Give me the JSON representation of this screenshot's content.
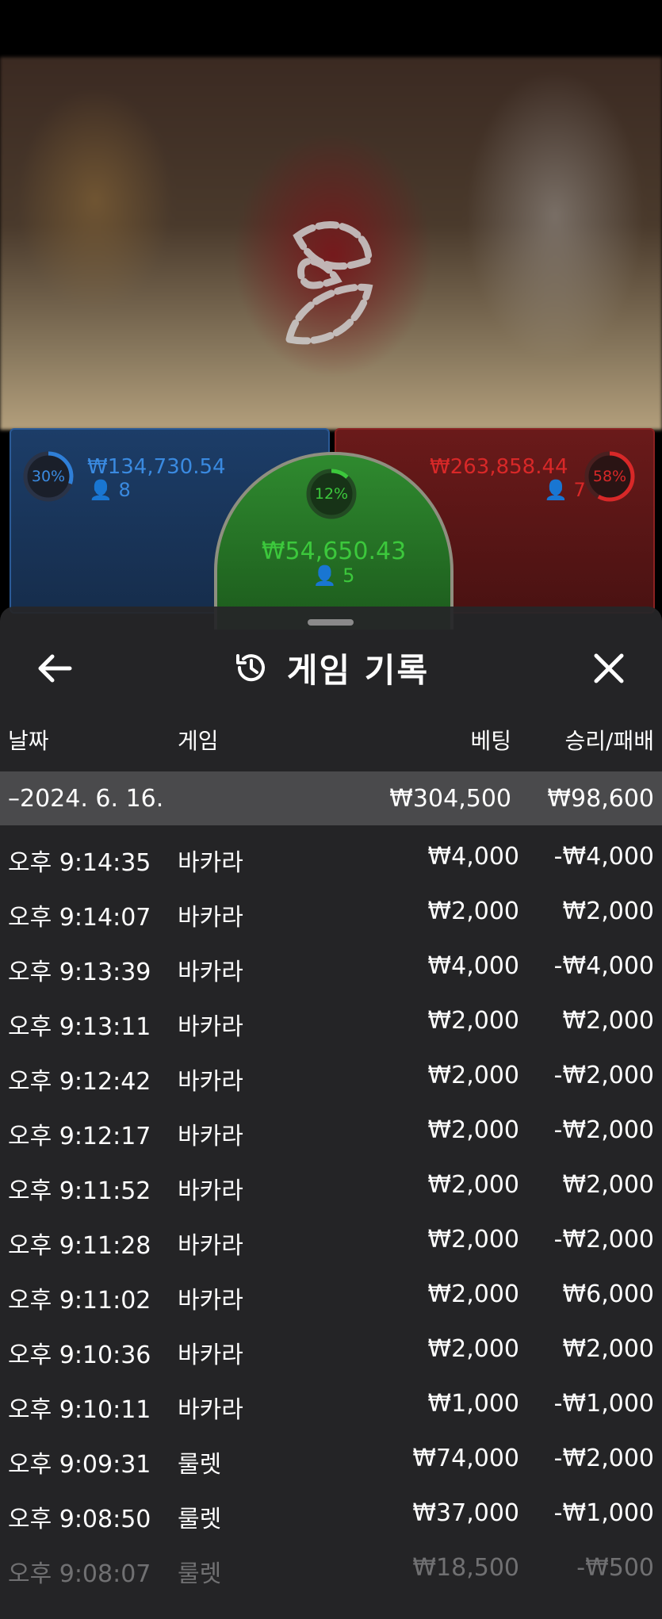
{
  "table": {
    "logo": "tulip-logo",
    "player": {
      "percent": "30%",
      "percent_value": 30,
      "amount": "₩134,730.54",
      "players": "8",
      "color": "#2f7fd8"
    },
    "tie": {
      "percent": "12%",
      "percent_value": 12,
      "amount": "₩54,650.43",
      "players": "5",
      "color": "#3cc83c"
    },
    "banker": {
      "percent": "58%",
      "percent_value": 58,
      "amount": "₩263,858.44",
      "players": "7",
      "color": "#d82828"
    }
  },
  "history": {
    "title": "게임 기록",
    "icons": {
      "back": "arrow-left-icon",
      "history": "history-icon",
      "close": "close-icon"
    },
    "columns": {
      "date": "날짜",
      "game": "게임",
      "bet": "베팅",
      "result": "승리/패배"
    },
    "date_group": {
      "date": "–2024. 6. 16.",
      "bet": "₩304,500",
      "result": "₩98,600"
    },
    "rows": [
      {
        "time": "오후 9:14:35",
        "game": "바카라",
        "bet": "₩4,000",
        "result": "-₩4,000"
      },
      {
        "time": "오후 9:14:07",
        "game": "바카라",
        "bet": "₩2,000",
        "result": "₩2,000"
      },
      {
        "time": "오후 9:13:39",
        "game": "바카라",
        "bet": "₩4,000",
        "result": "-₩4,000"
      },
      {
        "time": "오후 9:13:11",
        "game": "바카라",
        "bet": "₩2,000",
        "result": "₩2,000"
      },
      {
        "time": "오후 9:12:42",
        "game": "바카라",
        "bet": "₩2,000",
        "result": "-₩2,000"
      },
      {
        "time": "오후 9:12:17",
        "game": "바카라",
        "bet": "₩2,000",
        "result": "-₩2,000"
      },
      {
        "time": "오후 9:11:52",
        "game": "바카라",
        "bet": "₩2,000",
        "result": "₩2,000"
      },
      {
        "time": "오후 9:11:28",
        "game": "바카라",
        "bet": "₩2,000",
        "result": "-₩2,000"
      },
      {
        "time": "오후 9:11:02",
        "game": "바카라",
        "bet": "₩2,000",
        "result": "₩6,000"
      },
      {
        "time": "오후 9:10:36",
        "game": "바카라",
        "bet": "₩2,000",
        "result": "₩2,000"
      },
      {
        "time": "오후 9:10:11",
        "game": "바카라",
        "bet": "₩1,000",
        "result": "-₩1,000"
      },
      {
        "time": "오후 9:09:31",
        "game": "룰렛",
        "bet": "₩74,000",
        "result": "-₩2,000"
      },
      {
        "time": "오후 9:08:50",
        "game": "룰렛",
        "bet": "₩37,000",
        "result": "-₩1,000"
      },
      {
        "time": "오후 9:08:07",
        "game": "룰렛",
        "bet": "₩18,500",
        "result": "-₩500"
      }
    ]
  }
}
